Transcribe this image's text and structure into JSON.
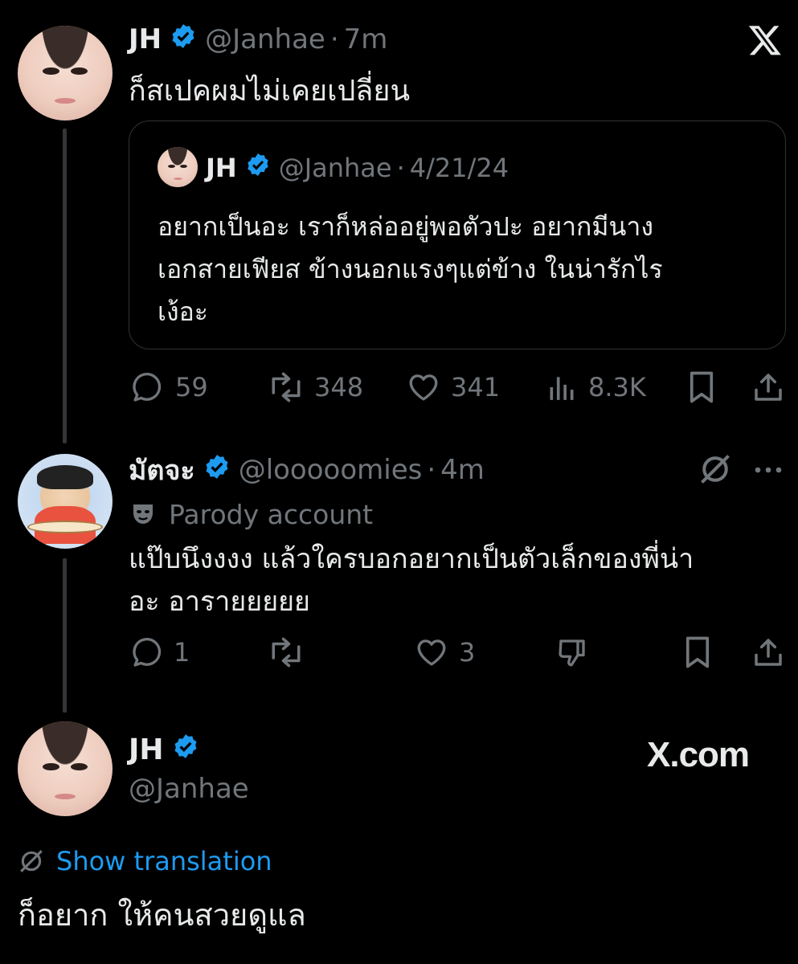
{
  "tweet": {
    "author": {
      "name": "JH",
      "handle": "@Janhae",
      "time": "7m"
    },
    "separator": "·",
    "text": "ก็สเปคผมไม่เคยเปลี่ยน",
    "quote": {
      "author": {
        "name": "JH",
        "handle": "@Janhae",
        "time": "4/21/24"
      },
      "text_lines": [
        "อยากเป็นอะ เราก็หล่ออยู่พอตัวปะ อยากมีนาง",
        "เอกสายเฟียส ข้างนอกแรงๆแต่ข้าง ในน่ารักไร",
        "เง้อะ"
      ]
    },
    "stats": {
      "replies": "59",
      "reposts": "348",
      "likes": "341",
      "views": "8.3K"
    }
  },
  "reply": {
    "author": {
      "name": "มัตจะ",
      "handle": "@looooomies",
      "time": "4m"
    },
    "badge": "Parody account",
    "text_lines": [
      "แป๊บนึงงงง แล้วใครบอกอยากเป็นตัวเล็กของพี่น่า",
      "อะ อารายยยยย"
    ],
    "stats": {
      "replies": "1",
      "reposts": "",
      "likes": "3"
    }
  },
  "footer": {
    "author": {
      "name": "JH",
      "handle": "@Janhae"
    },
    "brand": "X.com",
    "translation_link": "Show translation",
    "text": "ก็อยาก ให้คนสวยดูแล"
  },
  "icons": {
    "top_right": "x-logo-icon",
    "verified": "verified-badge-icon",
    "grok": "grok-icon",
    "more": "more-dots-icon",
    "parody": "mask-icon",
    "dislike": "thumbs-down-icon"
  },
  "colors": {
    "background": "#000000",
    "text": "#e7e9ea",
    "muted": "#71767b",
    "verified": "#1d9bf0",
    "link": "#1d9bf0"
  }
}
